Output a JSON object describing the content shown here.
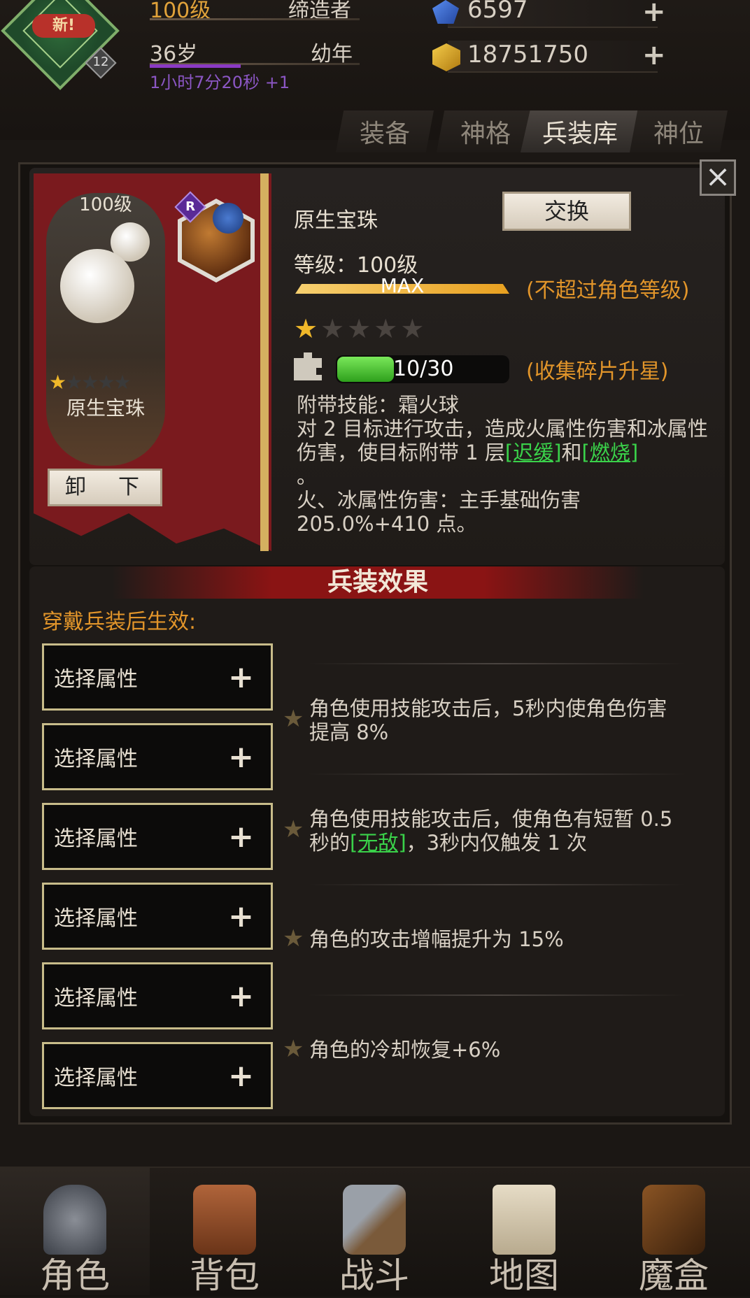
{
  "header": {
    "new_badge": "新!",
    "avatar_level": "12",
    "level_text": "100级",
    "title_text": "缔造者",
    "age_text": "36岁",
    "age_stage": "幼年",
    "timer_text": "1小时7分20秒 +1",
    "currency_blue": "6597",
    "currency_gold": "18751750"
  },
  "tabs": [
    {
      "label": "装备"
    },
    {
      "label": "神格"
    },
    {
      "label": "兵装库"
    },
    {
      "label": "神位"
    }
  ],
  "active_tab": "兵装库",
  "item": {
    "card_level": "100级",
    "card_name": "原生宝珠",
    "card_stars": 1,
    "card_stars_total": 5,
    "rarity_badge": "R",
    "unequip_label": "卸　下",
    "name": "原生宝珠",
    "swap_label": "交换",
    "level_label": "等级：100级",
    "max_label": "MAX",
    "level_note": "(不超过角色等级)",
    "stars": 1,
    "stars_total": 5,
    "fragments": "10/30",
    "fragment_fraction": 0.333,
    "fragment_note": "(收集碎片升星)",
    "skill_title": "附带技能：霜火球",
    "skill_desc_1": "对 2 目标进行攻击，造成火属性伤害和冰属性伤害，使目标附带 1 层",
    "skill_tag_1": "[迟缓]",
    "skill_and": "和",
    "skill_tag_2": "[燃烧]",
    "skill_period": "。",
    "skill_damage": "火、冰属性伤害：主手基础伤害 205.0%+410 点。"
  },
  "effects": {
    "title": "兵装效果",
    "wear_note": "穿戴兵装后生效:",
    "slots": [
      {
        "label": "选择属性"
      },
      {
        "label": "选择属性"
      },
      {
        "label": "选择属性"
      },
      {
        "label": "选择属性"
      },
      {
        "label": "选择属性"
      },
      {
        "label": "选择属性"
      }
    ],
    "bonuses": [
      {
        "text": "角色使用技能攻击后，5秒内使角色伤害提高 8%"
      },
      {
        "text_pre": "角色使用技能攻击后，使角色有短暂 0.5 秒的",
        "tag": "[无敌]",
        "text_post": "，3秒内仅触发 1 次"
      },
      {
        "text": "角色的攻击增幅提升为 15%"
      },
      {
        "text": "角色的冷却恢复+6%"
      }
    ]
  },
  "nav": [
    {
      "label": "角色",
      "icon": "helmet-icon"
    },
    {
      "label": "背包",
      "icon": "backpack-icon"
    },
    {
      "label": "战斗",
      "icon": "sword-shield-icon"
    },
    {
      "label": "地图",
      "icon": "scroll-icon"
    },
    {
      "label": "魔盒",
      "icon": "magic-box-icon"
    }
  ],
  "colors": {
    "accent_orange": "#e2952a",
    "banner_red": "#7a1a1e",
    "green_tag": "#3ad24a",
    "star_gold": "#f0b82a"
  }
}
